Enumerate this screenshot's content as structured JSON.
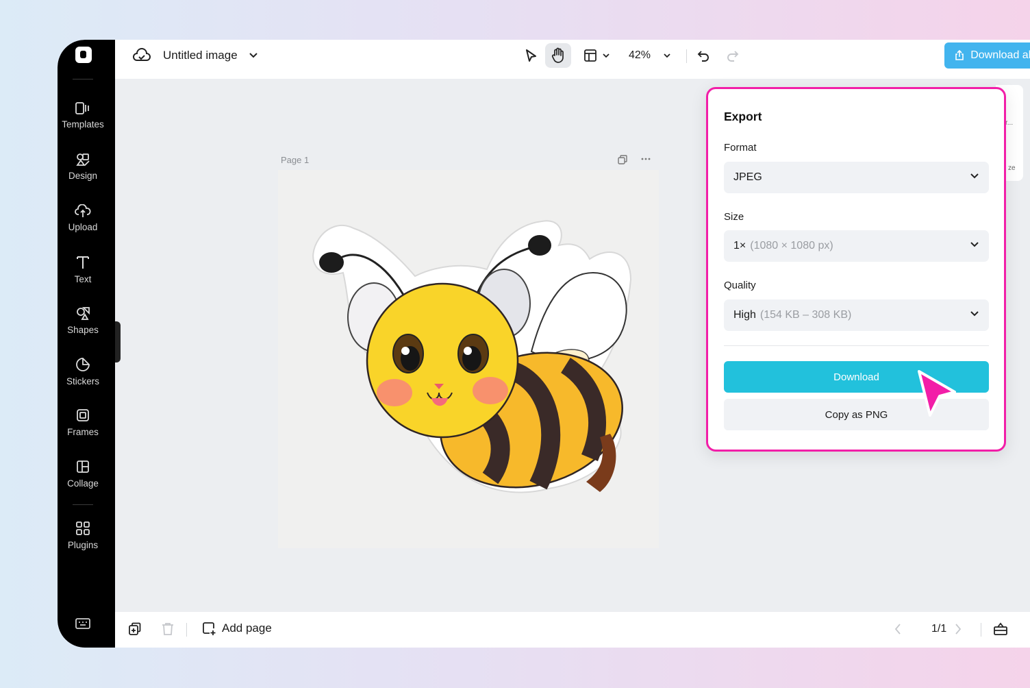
{
  "app": {
    "title": "Untitled image"
  },
  "sidebar": {
    "items": [
      {
        "label": "Templates",
        "icon": "templates-icon"
      },
      {
        "label": "Design",
        "icon": "design-icon"
      },
      {
        "label": "Upload",
        "icon": "upload-icon"
      },
      {
        "label": "Text",
        "icon": "text-icon"
      },
      {
        "label": "Shapes",
        "icon": "shapes-icon"
      },
      {
        "label": "Stickers",
        "icon": "stickers-icon"
      },
      {
        "label": "Frames",
        "icon": "frames-icon"
      },
      {
        "label": "Collage",
        "icon": "collage-icon"
      },
      {
        "label": "Plugins",
        "icon": "plugins-icon"
      }
    ]
  },
  "toolbar": {
    "zoom": "42%",
    "download_all_label": "Download all"
  },
  "canvas": {
    "page_label": "Page 1",
    "image_description_icon": "bee-sticker-image"
  },
  "export_panel": {
    "title": "Export",
    "format_label": "Format",
    "format_value": "JPEG",
    "size_label": "Size",
    "size_value": "1×",
    "size_detail": "(1080 × 1080 px)",
    "quality_label": "Quality",
    "quality_value": "High",
    "quality_detail": "(154 KB – 308 KB)",
    "download_label": "Download",
    "copy_label": "Copy as PNG"
  },
  "bottom": {
    "add_page_label": "Add page",
    "pager": "1/1"
  },
  "colors": {
    "accent_download_all": "#42b4ee",
    "accent_download": "#22c1dc",
    "highlight_border": "#f21ea8",
    "cursor": "#f21ea8"
  }
}
